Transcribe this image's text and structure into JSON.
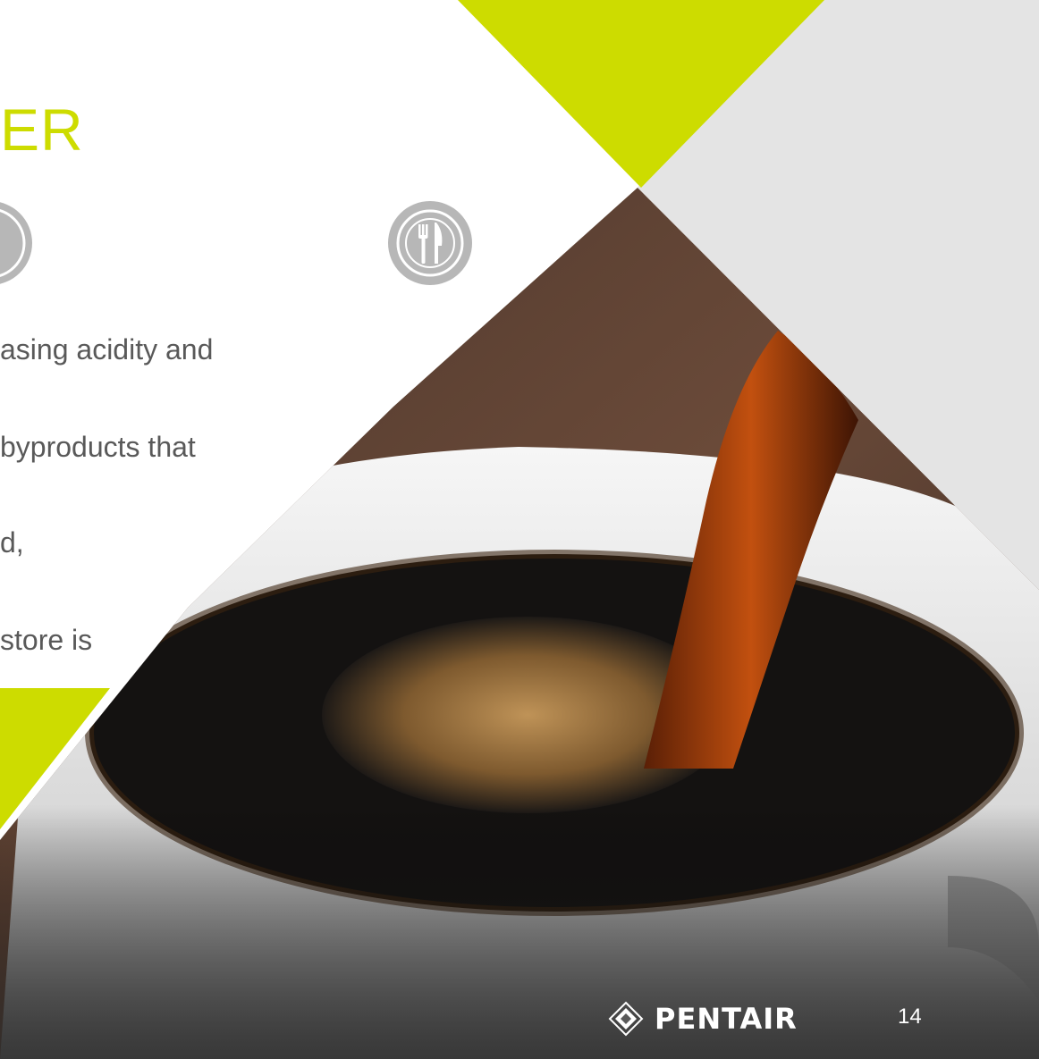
{
  "slide": {
    "title": "ER",
    "bullets": [
      "asing acidity and",
      "byproducts that",
      "d,",
      "store is"
    ],
    "icons": [
      "partial-round-icon",
      "dining-icon"
    ],
    "logo_text": "PENTAIR",
    "page_number": "14"
  },
  "colors": {
    "accent": "#cddc00",
    "panel_gray": "#e4e4e4",
    "icon_gray": "#b7b7b7",
    "body_text": "#595959",
    "coffee_dark": "#141211"
  }
}
